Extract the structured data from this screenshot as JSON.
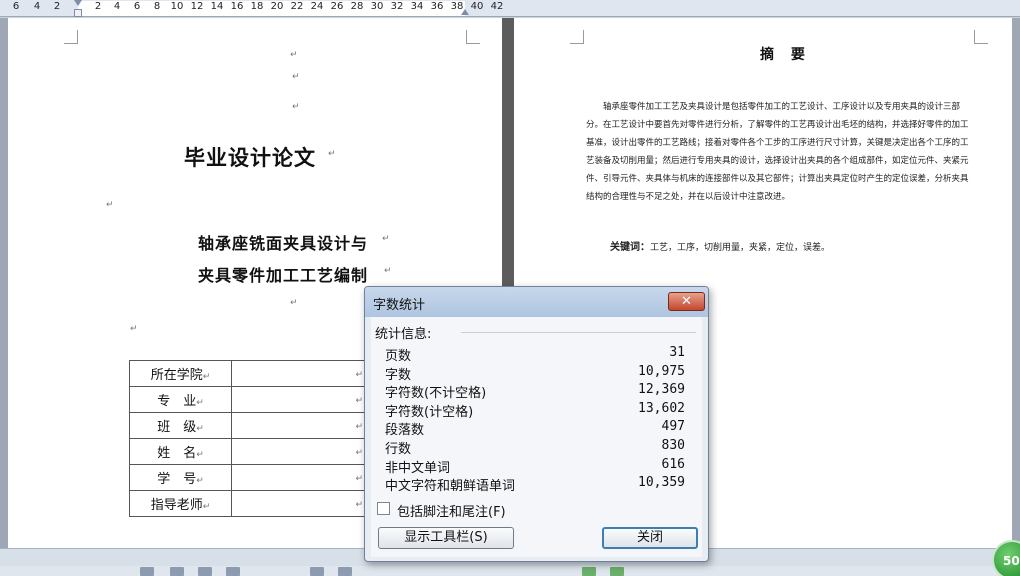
{
  "ruler": {
    "labels": [
      "6",
      "4",
      "2",
      "2",
      "4",
      "6",
      "8",
      "10",
      "12",
      "14",
      "16",
      "18",
      "20",
      "22",
      "24",
      "26",
      "28",
      "30",
      "32",
      "34",
      "36",
      "38",
      "40",
      "42"
    ]
  },
  "cover_page": {
    "title": "毕业设计论文",
    "subtitle_line1": "轴承座铣面夹具设计与",
    "subtitle_line2": "夹具零件加工工艺编制",
    "table": [
      {
        "label": "所在学院",
        "value": ""
      },
      {
        "label": "专　业",
        "value": ""
      },
      {
        "label": "班　级",
        "value": ""
      },
      {
        "label": "姓　名",
        "value": ""
      },
      {
        "label": "学　号",
        "value": ""
      },
      {
        "label": "指导老师",
        "value": ""
      }
    ]
  },
  "abstract_page": {
    "title": "摘 要",
    "body": "轴承座零件加工工艺及夹具设计是包括零件加工的工艺设计、工序设计以及专用夹具的设计三部分。在工艺设计中要首先对零件进行分析，了解零件的工艺再设计出毛坯的结构，并选择好零件的加工基准，设计出零件的工艺路线；接着对零件各个工步的工序进行尺寸计算，关键是决定出各个工序的工艺装备及切削用量；然后进行专用夹具的设计，选择设计出夹具的各个组成部件，如定位元件、夹紧元件、引导元件、夹具体与机床的连接部件以及其它部件；计算出夹具定位时产生的定位误差，分析夹具结构的合理性与不足之处，并在以后设计中注意改进。",
    "keywords_label": "关键词：",
    "keywords": "工艺，工序，切削用量，夹紧，定位，误差。"
  },
  "dialog": {
    "title": "字数统计",
    "close_glyph": "✕",
    "section_label": "统计信息:",
    "stats": [
      {
        "label": "页数",
        "value": "31"
      },
      {
        "label": "字数",
        "value": "10,975"
      },
      {
        "label": "字符数(不计空格)",
        "value": "12,369"
      },
      {
        "label": "字符数(计空格)",
        "value": "13,602"
      },
      {
        "label": "段落数",
        "value": "497"
      },
      {
        "label": "行数",
        "value": "830"
      },
      {
        "label": "非中文单词",
        "value": "616"
      },
      {
        "label": "中文字符和朝鲜语单词",
        "value": "10,359"
      }
    ],
    "checkbox_label": "包括脚注和尾注(F)",
    "checkbox_checked": false,
    "toolbar_button": "显示工具栏(S)",
    "close_button": "关闭"
  },
  "zoom": {
    "value": "50"
  }
}
